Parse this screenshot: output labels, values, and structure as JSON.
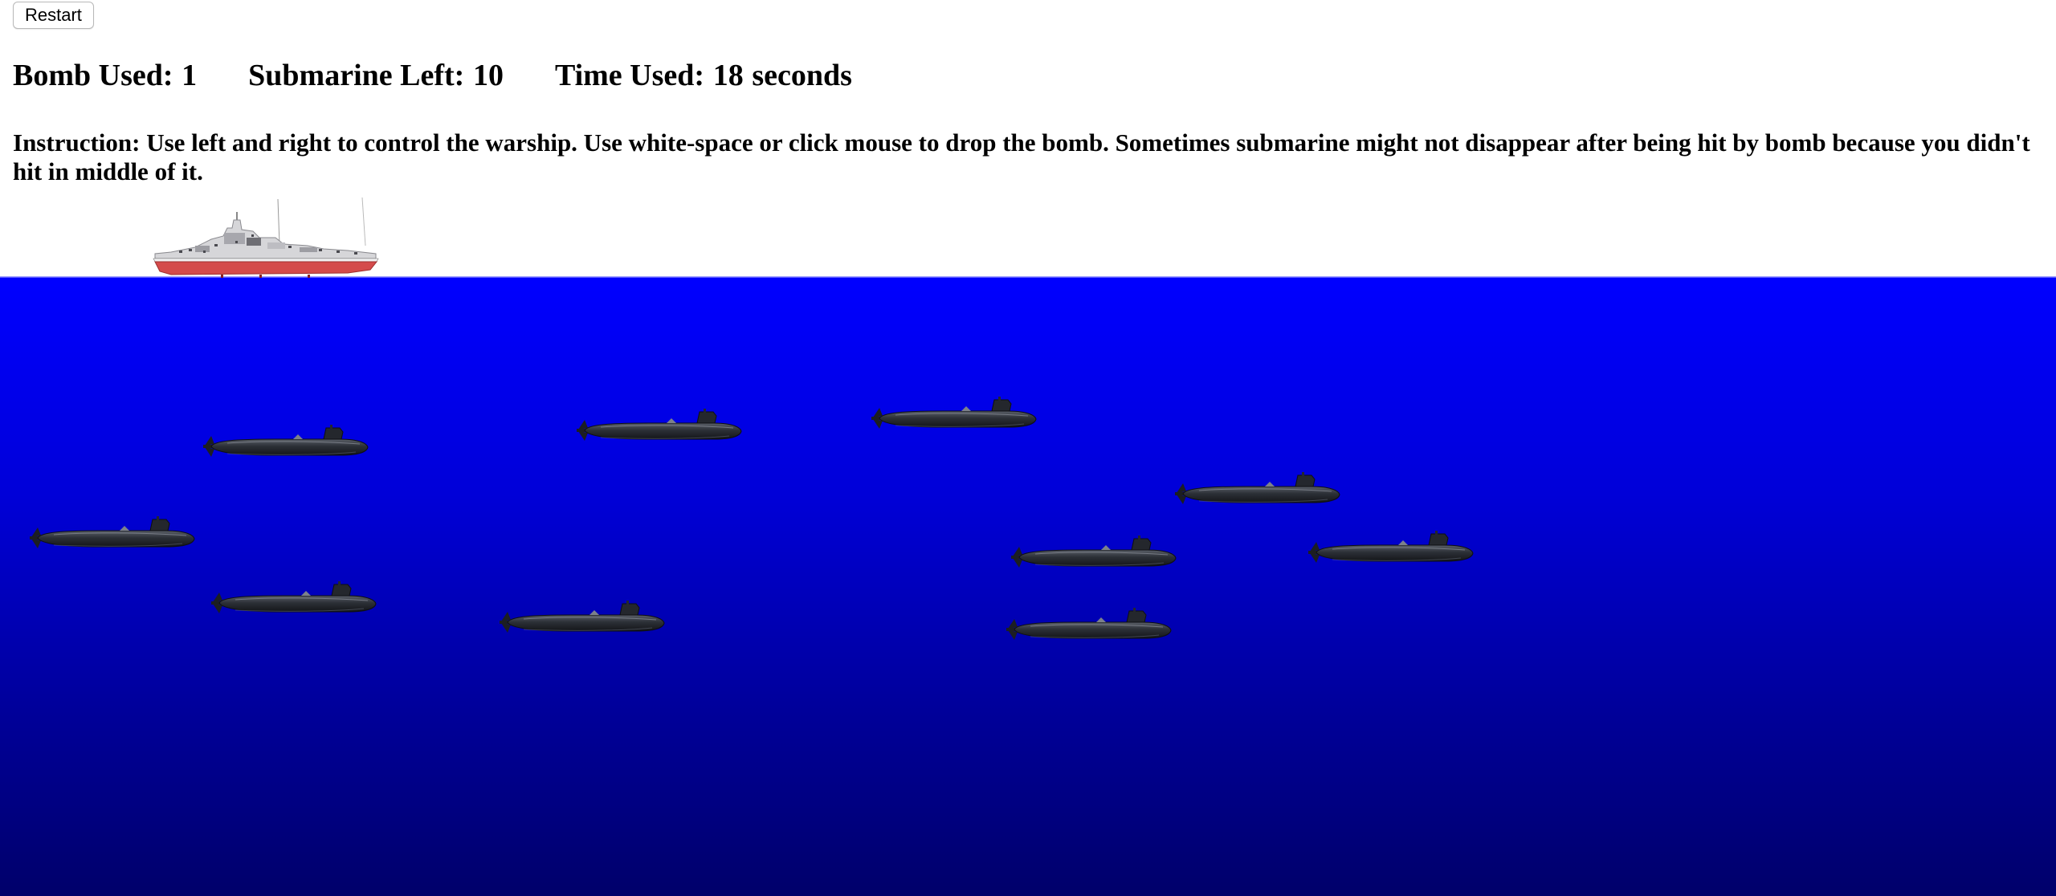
{
  "toolbar": {
    "restart_label": "Restart"
  },
  "stats": {
    "bomb_used_label": "Bomb Used:",
    "bomb_used_value": "1",
    "submarine_left_label": "Submarine Left:",
    "submarine_left_value": "10",
    "time_used_label": "Time Used:",
    "time_used_value": "18",
    "time_used_unit": "seconds"
  },
  "instruction": {
    "text": "Instruction: Use left and right to control the warship. Use white-space or click mouse to drop the bomb. Sometimes submarine might not disappear after being hit by bomb because you didn't hit in middle of it."
  },
  "game": {
    "warship_icon": "warship-icon",
    "submarine_icon": "submarine-icon",
    "submarine_count_visible": 10,
    "colors": {
      "sea_top": "#0000ff",
      "sea_bottom": "#00006a",
      "submarine_body": "#2b2f36",
      "warship_hull": "#d44b4b",
      "warship_superstructure": "#cfcfd2"
    }
  }
}
